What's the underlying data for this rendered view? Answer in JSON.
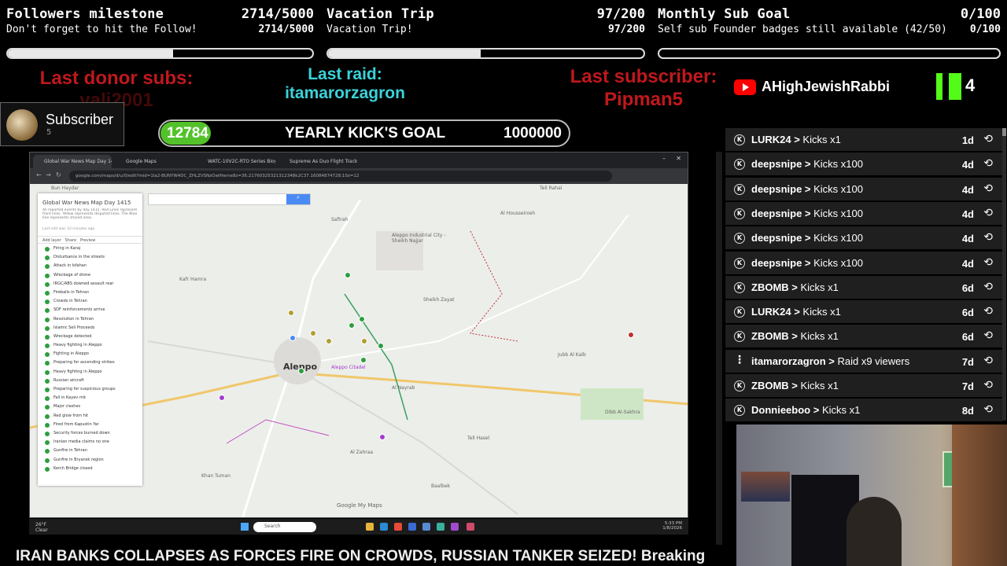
{
  "goals": [
    {
      "title": "Followers milestone",
      "count": "2714/5000",
      "subtitle": "Don't forget to hit the Follow!",
      "count2": "2714/5000",
      "progress": 0.543
    },
    {
      "title": "Vacation Trip",
      "count": "97/200",
      "subtitle": "Vacation Trip!",
      "count2": "97/200",
      "progress": 0.485
    },
    {
      "title": "Monthly Sub Goal",
      "count": "0/100",
      "subtitle": "Self sub Founder badges still available (42/50)",
      "count2": "0/100",
      "progress": 0.0
    }
  ],
  "labels": {
    "last_donor_title": "Last donor subs:",
    "last_donor_name": "vali2001",
    "last_raid_title": "Last raid:",
    "last_raid_name": "itamarorzagron",
    "last_sub_title": "Last subscriber:",
    "last_sub_name": "Pipman5"
  },
  "subscriber_box": {
    "title": "Subscriber",
    "count": "5"
  },
  "kick_goal": {
    "current": "12784",
    "label": "YEARLY KICK'S GOAL",
    "target": "1000000"
  },
  "channel": {
    "youtube_name": "AHighJewishRabbi",
    "kick_count": "4",
    "colors": {
      "youtube": "#ff0000",
      "kick": "#53fc18"
    }
  },
  "browser": {
    "tabs": [
      "Global War News Map Day 14...",
      "Google Maps",
      "WATC-10V2C-RTO Series Biograph...",
      "Supreme As Duo Flight Tracker"
    ],
    "url": "google.com/maps/d/u/0/edit?mid=1la2-BUNYW4DC_ZHLZVSNzOwlHerne8z=36.21760325321312348k2C37.16084874728;10z=12",
    "sidebar_title": "Global War News Map Day 1415",
    "sidebar_desc": "All reported events by day 1415. Red Lines represent front lines. Yellow represents disputed lines. The Blue line represents shared area.",
    "sidebar_edit": "Last edit was 10 minutes ago",
    "sidebar_actions": [
      "Add layer",
      "Share",
      "Preview"
    ],
    "layers": [
      "Firing in Karaj",
      "Disturbance in the streets",
      "Attack in Isfahan",
      "Wreckage of drone",
      "IRGC/ABS downed assault rear",
      "Fireballs in Tehran",
      "Crowds in Tehran",
      "SDF reinforcements arrive",
      "Revolution in Tehran",
      "Islamic Seli Proceeds",
      "Wreckage detected",
      "Heavy fighting in Aleppo",
      "Fighting in Aleppo",
      "Preparing for ascending strikes",
      "Heavy fighting in Aleppo",
      "Russian aircraft",
      "Preparing for suspicious groups",
      "Fall in Kayev mit",
      "Major clashes",
      "Red glow from hit",
      "Fired from Kapustin Yar",
      "Security forces burned down",
      "Iranian media claims no one",
      "Gunfire in Tehran",
      "Gunfire in Bryansk region",
      "Kerch Bridge closed"
    ],
    "map_city": "Aleppo",
    "map_places": [
      "Bun Haydar",
      "Tell Rahal",
      "Safirah",
      "Al Housseinieh",
      "Aleppo Industrial City - Sheikh Najjar",
      "Sheikh Zayat",
      "Al Nayrab",
      "Aleppo Citadel",
      "Kafr Hamra",
      "Khan Tuman",
      "Al Zahraa",
      "Baalbek",
      "Dibb Al-Sakhra",
      "Tell Hasel",
      "Jubb Al Kalb",
      "Google My Maps"
    ],
    "taskbar_search": "Search",
    "weather": "26°F Clear",
    "clock": "5:33 PM 1/8/2026"
  },
  "ticker": "IRAN BANKS COLLAPSES AS FORCES FIRE ON CROWDS, RUSSIAN TANKER SEIZED! Breaking",
  "events": [
    {
      "user": "LURK24",
      "action": "Kicks x1",
      "age": "1d",
      "icon": "kick-icon"
    },
    {
      "user": "deepsnipe",
      "action": "Kicks x100",
      "age": "4d",
      "icon": "kick-icon"
    },
    {
      "user": "deepsnipe",
      "action": "Kicks x100",
      "age": "4d",
      "icon": "kick-icon"
    },
    {
      "user": "deepsnipe",
      "action": "Kicks x100",
      "age": "4d",
      "icon": "kick-icon"
    },
    {
      "user": "deepsnipe",
      "action": "Kicks x100",
      "age": "4d",
      "icon": "kick-icon"
    },
    {
      "user": "deepsnipe",
      "action": "Kicks x100",
      "age": "4d",
      "icon": "kick-icon"
    },
    {
      "user": "ZBOMB",
      "action": "Kicks x1",
      "age": "6d",
      "icon": "kick-icon"
    },
    {
      "user": "LURK24",
      "action": "Kicks x1",
      "age": "6d",
      "icon": "kick-icon"
    },
    {
      "user": "ZBOMB",
      "action": "Kicks x1",
      "age": "6d",
      "icon": "kick-icon"
    },
    {
      "user": "itamarorzagron",
      "action": "Raid x9 viewers",
      "age": "7d",
      "icon": "raid-icon"
    },
    {
      "user": "ZBOMB",
      "action": "Kicks x1",
      "age": "7d",
      "icon": "kick-icon"
    },
    {
      "user": "Donnieeboo",
      "action": "Kicks x1",
      "age": "8d",
      "icon": "kick-icon"
    }
  ]
}
